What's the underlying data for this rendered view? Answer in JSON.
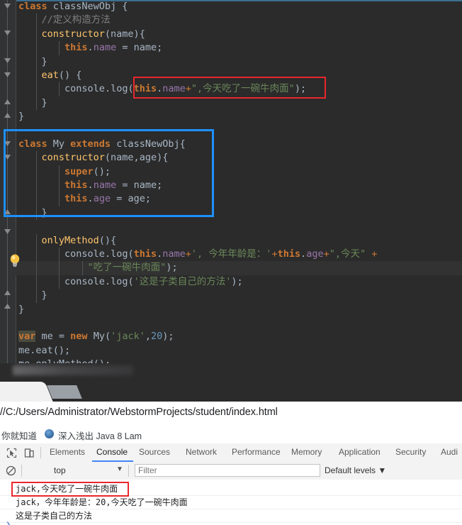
{
  "editor": {
    "theme_bg": "#2b2b2b",
    "lines": [
      {
        "tokens": [
          {
            "t": "class",
            "c": "kw"
          },
          {
            "t": " classNewObj {",
            "c": "ident"
          }
        ]
      },
      {
        "indent": 1,
        "tokens": [
          {
            "t": "//定义构造方法",
            "c": "cmt"
          }
        ]
      },
      {
        "indent": 1,
        "tokens": [
          {
            "t": "constructor",
            "c": "fn"
          },
          {
            "t": "(name){",
            "c": "punc"
          }
        ]
      },
      {
        "indent": 2,
        "tokens": [
          {
            "t": "this",
            "c": "kw"
          },
          {
            "t": ".",
            "c": "punc"
          },
          {
            "t": "name",
            "c": "field"
          },
          {
            "t": " = name;",
            "c": "ident"
          }
        ]
      },
      {
        "indent": 1,
        "tokens": [
          {
            "t": "}",
            "c": "punc"
          }
        ]
      },
      {
        "indent": 1,
        "tokens": [
          {
            "t": "eat",
            "c": "fn"
          },
          {
            "t": "() {",
            "c": "punc"
          }
        ]
      },
      {
        "indent": 2,
        "tokens": [
          {
            "t": "console",
            "c": "ident"
          },
          {
            "t": ".",
            "c": "punc"
          },
          {
            "t": "log",
            "c": "ident"
          },
          {
            "t": "(",
            "c": "punc"
          },
          {
            "t": "this",
            "c": "kw"
          },
          {
            "t": ".",
            "c": "punc"
          },
          {
            "t": "name",
            "c": "field"
          },
          {
            "t": "+",
            "c": "kw2"
          },
          {
            "t": "\",今天吃了一碗牛肉面\"",
            "c": "str"
          },
          {
            "t": ");",
            "c": "punc"
          }
        ]
      },
      {
        "indent": 1,
        "tokens": [
          {
            "t": "}",
            "c": "punc"
          }
        ]
      },
      {
        "indent": 0,
        "tokens": [
          {
            "t": "}",
            "c": "punc"
          }
        ]
      },
      {
        "tokens": []
      },
      {
        "tokens": [
          {
            "t": "class",
            "c": "kw"
          },
          {
            "t": " My ",
            "c": "ident"
          },
          {
            "t": "extends",
            "c": "kw"
          },
          {
            "t": " classNewObj{",
            "c": "ident"
          }
        ]
      },
      {
        "indent": 1,
        "tokens": [
          {
            "t": "constructor",
            "c": "fn"
          },
          {
            "t": "(name,age){",
            "c": "punc"
          }
        ]
      },
      {
        "indent": 2,
        "tokens": [
          {
            "t": "super",
            "c": "kw"
          },
          {
            "t": "();",
            "c": "punc"
          }
        ]
      },
      {
        "indent": 2,
        "tokens": [
          {
            "t": "this",
            "c": "kw"
          },
          {
            "t": ".",
            "c": "punc"
          },
          {
            "t": "name",
            "c": "field"
          },
          {
            "t": " = name;",
            "c": "ident"
          }
        ]
      },
      {
        "indent": 2,
        "tokens": [
          {
            "t": "this",
            "c": "kw"
          },
          {
            "t": ".",
            "c": "punc"
          },
          {
            "t": "age",
            "c": "field"
          },
          {
            "t": " = age;",
            "c": "ident"
          }
        ]
      },
      {
        "indent": 1,
        "tokens": [
          {
            "t": "}",
            "c": "punc"
          }
        ]
      },
      {
        "tokens": []
      },
      {
        "indent": 1,
        "tokens": [
          {
            "t": "onlyMethod",
            "c": "fn"
          },
          {
            "t": "(){",
            "c": "punc"
          }
        ]
      },
      {
        "indent": 2,
        "tokens": [
          {
            "t": "console",
            "c": "ident"
          },
          {
            "t": ".",
            "c": "punc"
          },
          {
            "t": "log",
            "c": "ident"
          },
          {
            "t": "(",
            "c": "punc"
          },
          {
            "t": "this",
            "c": "kw"
          },
          {
            "t": ".",
            "c": "punc"
          },
          {
            "t": "name",
            "c": "field"
          },
          {
            "t": "+",
            "c": "kw2"
          },
          {
            "t": "', 今年年龄是：'",
            "c": "str"
          },
          {
            "t": "+",
            "c": "kw2"
          },
          {
            "t": "this",
            "c": "kw"
          },
          {
            "t": ".",
            "c": "punc"
          },
          {
            "t": "age",
            "c": "field"
          },
          {
            "t": "+",
            "c": "kw2"
          },
          {
            "t": "\",今天\"",
            "c": "str"
          },
          {
            "t": " +",
            "c": "kw2"
          }
        ]
      },
      {
        "indent": 3,
        "current": true,
        "tokens": [
          {
            "t": "\"吃了一碗牛肉面\"",
            "c": "str"
          },
          {
            "t": ");",
            "c": "punc"
          }
        ]
      },
      {
        "indent": 2,
        "tokens": [
          {
            "t": "console",
            "c": "ident"
          },
          {
            "t": ".",
            "c": "punc"
          },
          {
            "t": "log",
            "c": "ident"
          },
          {
            "t": "(",
            "c": "punc"
          },
          {
            "t": "'这是子类自己的方法'",
            "c": "str"
          },
          {
            "t": ");",
            "c": "punc"
          }
        ]
      },
      {
        "indent": 1,
        "tokens": [
          {
            "t": "}",
            "c": "punc"
          }
        ]
      },
      {
        "indent": 0,
        "tokens": [
          {
            "t": "}",
            "c": "punc"
          }
        ]
      },
      {
        "tokens": []
      },
      {
        "tokens": [
          {
            "t": "var",
            "c": "varhl"
          },
          {
            "t": " me = ",
            "c": "ident"
          },
          {
            "t": "new",
            "c": "kw"
          },
          {
            "t": " My(",
            "c": "ident"
          },
          {
            "t": "'jack'",
            "c": "str"
          },
          {
            "t": ",",
            "c": "punc"
          },
          {
            "t": "20",
            "c": "num"
          },
          {
            "t": ");",
            "c": "punc"
          }
        ]
      },
      {
        "tokens": [
          {
            "t": "me",
            "c": "ident"
          },
          {
            "t": ".",
            "c": "punc"
          },
          {
            "t": "eat",
            "c": "ident"
          },
          {
            "t": "();",
            "c": "punc"
          }
        ]
      },
      {
        "tokens": [
          {
            "t": "me",
            "c": "ident"
          },
          {
            "t": ".",
            "c": "punc"
          },
          {
            "t": "onlyMethod",
            "c": "ident"
          },
          {
            "t": "();",
            "c": "punc"
          }
        ]
      }
    ],
    "annotations": {
      "red_highlight_label": "this.name+\",今天吃了一碗牛肉面\"",
      "blue_highlight_label": "class My extends classNewObj constructor block"
    }
  },
  "browser": {
    "url": "//C:/Users/Administrator/WebstormProjects/student/index.html",
    "tab_close_glyph": "×",
    "bookmarks": [
      {
        "label": "你就知道"
      },
      {
        "label": "深入浅出 Java 8 Lam"
      }
    ]
  },
  "devtools": {
    "tabs": [
      {
        "label": "Elements",
        "selected": false
      },
      {
        "label": "Console",
        "selected": true
      },
      {
        "label": "Sources",
        "selected": false
      },
      {
        "label": "Network",
        "selected": false
      },
      {
        "label": "Performance",
        "selected": false
      },
      {
        "label": "Memory",
        "selected": false
      },
      {
        "label": "Application",
        "selected": false
      },
      {
        "label": "Security",
        "selected": false
      },
      {
        "label": "Audi",
        "selected": false
      }
    ],
    "accent_color": "#4285f4",
    "context_selector": {
      "value": "top",
      "caret": "▼"
    },
    "filter": {
      "value": "",
      "placeholder": "Filter"
    },
    "levels": {
      "label": "Default levels",
      "caret": "▼"
    },
    "console_messages": [
      {
        "text": "jack,今天吃了一碗牛肉面",
        "highlighted": true
      },
      {
        "text": "jack，今年年龄是：20,今天吃了一碗牛肉面",
        "highlighted": false
      },
      {
        "text": "这是子类自己的方法",
        "highlighted": false
      }
    ],
    "prompt_glyph": "❯"
  }
}
